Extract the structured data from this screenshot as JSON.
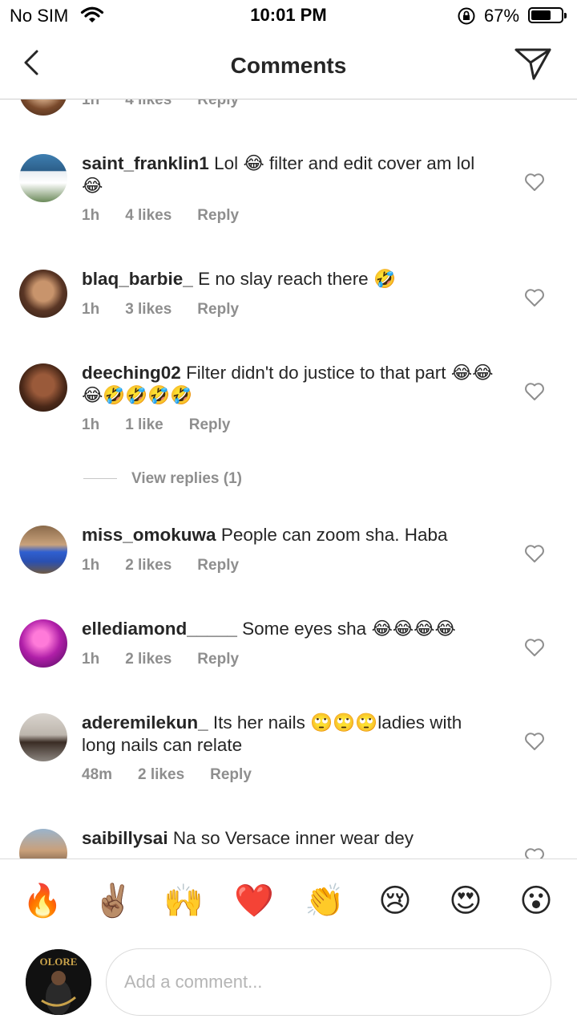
{
  "status_bar": {
    "carrier": "No SIM",
    "time": "10:01 PM",
    "battery_percent": "67%",
    "battery_level": 0.67
  },
  "header": {
    "title": "Comments"
  },
  "partial_comment": {
    "time": "1h",
    "likes": "4 likes",
    "reply": "Reply"
  },
  "comments": [
    {
      "username": "saint_franklin1",
      "text": "Lol 😂 filter and edit cover am lol 😂",
      "time": "1h",
      "likes": "4 likes",
      "reply": "Reply"
    },
    {
      "username": "blaq_barbie_",
      "text": "E no slay reach there 🤣",
      "time": "1h",
      "likes": "3 likes",
      "reply": "Reply"
    },
    {
      "username": "deeching02",
      "text": "Filter didn't do justice to that part 😂😂😂🤣🤣🤣🤣",
      "time": "1h",
      "likes": "1 like",
      "reply": "Reply"
    },
    {
      "username": "miss_omokuwa",
      "text": "People can zoom sha. Haba",
      "time": "1h",
      "likes": "2 likes",
      "reply": "Reply"
    },
    {
      "username": "ellediamond_____",
      "text": "Some eyes sha 😂😂😂😂",
      "time": "1h",
      "likes": "2 likes",
      "reply": "Reply"
    },
    {
      "username": "aderemilekun_",
      "text": "Its her nails 🙄🙄🙄ladies with long nails can relate",
      "time": "48m",
      "likes": "2 likes",
      "reply": "Reply"
    },
    {
      "username": "saibillysai",
      "text": "Na so Versace inner wear dey"
    }
  ],
  "view_replies": "View replies (1)",
  "reactions": [
    "🔥",
    "✌🏽",
    "🙌",
    "❤️",
    "👏",
    "😢",
    "😍",
    "😮"
  ],
  "composer": {
    "placeholder": "Add a comment...",
    "avatar_text": "OLORE"
  }
}
